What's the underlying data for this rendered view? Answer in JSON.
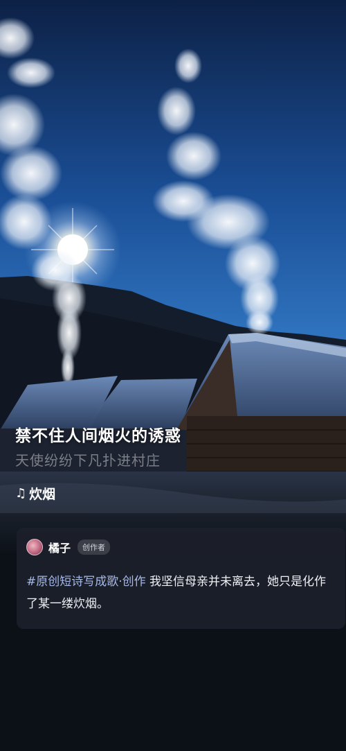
{
  "lyrics": {
    "current": "禁不住人间烟火的诱惑",
    "next": "天使纷纷下凡扑进村庄"
  },
  "song": {
    "icon": "music-note-icon",
    "title": "炊烟"
  },
  "author": {
    "name": "橘子",
    "role_badge": "创作者"
  },
  "post": {
    "hashtag": "#原创短诗写成歌·创作",
    "text": " 我坚信母亲并未离去，她只是化作了某一缕炊烟。"
  },
  "colors": {
    "sky_top": "#0e2a55",
    "sky_mid": "#1f5aa5",
    "snow": "#e8eef6",
    "bg": "#0c1118",
    "hashtag": "#a7b9e8"
  }
}
